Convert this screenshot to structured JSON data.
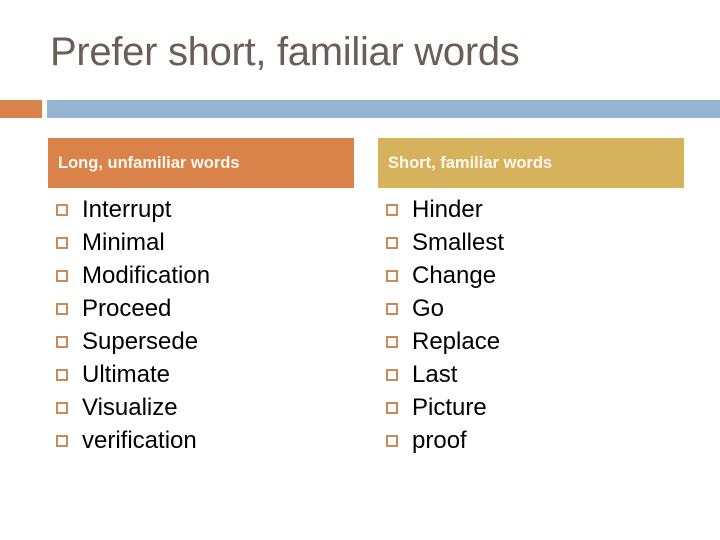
{
  "slide": {
    "title": "Prefer short, familiar words",
    "colors": {
      "orange": "#d9824a",
      "blue": "#95b4d1",
      "gold": "#d6b25d",
      "title": "#6b5d58"
    },
    "left_column": {
      "header": "Long, unfamiliar words",
      "items": [
        "Interrupt",
        "Minimal",
        "Modification",
        "Proceed",
        "Supersede",
        "Ultimate",
        "Visualize",
        "verification"
      ]
    },
    "right_column": {
      "header": "Short, familiar words",
      "items": [
        "Hinder",
        "Smallest",
        "Change",
        "Go",
        "Replace",
        "Last",
        "Picture",
        "proof"
      ]
    }
  }
}
